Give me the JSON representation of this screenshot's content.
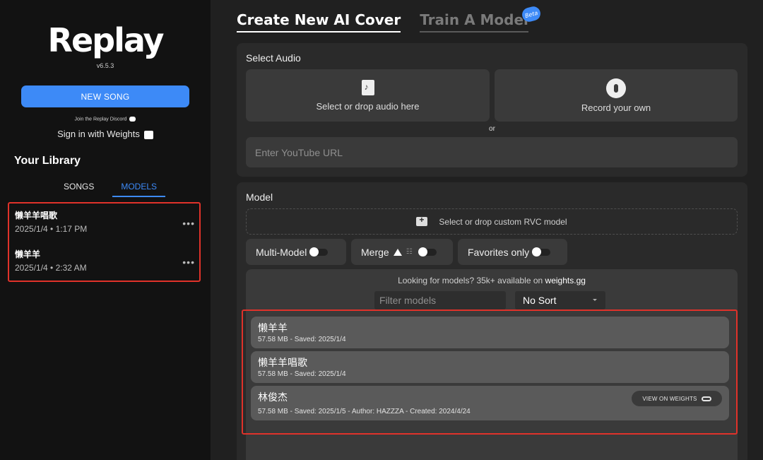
{
  "app": {
    "logo": "Replay",
    "version": "v6.5.3"
  },
  "sidebar": {
    "new_song": "NEW SONG",
    "discord": "Join the Replay Discord",
    "signin": "Sign in with Weights",
    "library_title": "Your Library",
    "tabs": [
      "SONGS",
      "MODELS"
    ],
    "active_tab": "MODELS",
    "items": [
      {
        "name": "懒羊羊唱歌",
        "date": "2025/1/4 • 1:17 PM",
        "more": "•••"
      },
      {
        "name": "懒羊羊",
        "date": "2025/1/4 • 2:32 AM",
        "more": "•••"
      }
    ]
  },
  "tabs": {
    "create": "Create New AI Cover",
    "train": "Train A Model",
    "beta": "Beta"
  },
  "audio": {
    "title": "Select Audio",
    "drop_label": "Select or drop audio here",
    "record_label": "Record your own",
    "or": "or",
    "youtube_placeholder": "Enter YouTube URL"
  },
  "model": {
    "title": "Model",
    "custom_rvc": "Select or drop custom RVC model",
    "toggles": {
      "multi_model": "Multi-Model",
      "merge": "Merge",
      "favorites": "Favorites only"
    },
    "looking_prefix": "Looking for models? 35k+ available on ",
    "looking_link": "weights.gg",
    "filter_placeholder": "Filter models",
    "sort": "No Sort",
    "view_on_weights": "VIEW ON WEIGHTS",
    "list": [
      {
        "name": "懒羊羊",
        "meta": "57.58 MB - Saved: 2025/1/4"
      },
      {
        "name": "懒羊羊唱歌",
        "meta": "57.58 MB - Saved: 2025/1/4"
      },
      {
        "name": "林俊杰",
        "meta": "57.58 MB - Saved: 2025/1/5 - Author: HAZZZA - Created: 2024/4/24"
      }
    ]
  },
  "colors": {
    "accent": "#3d8af7",
    "highlight": "#e0322a"
  }
}
